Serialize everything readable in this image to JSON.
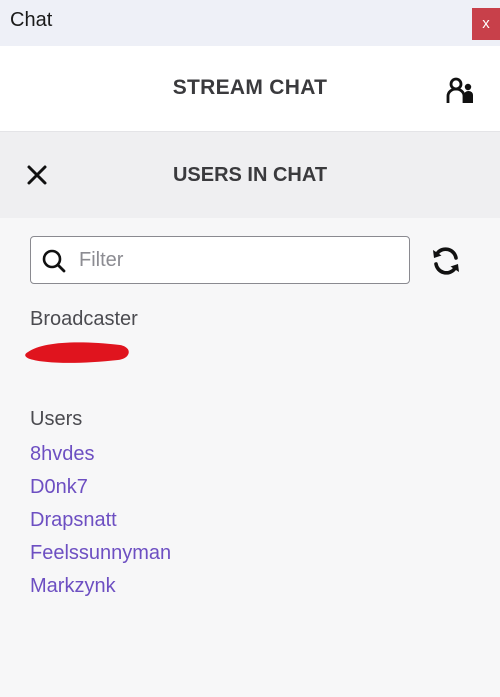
{
  "window": {
    "title": "Chat",
    "close_label": "x"
  },
  "header": {
    "title": "STREAM CHAT",
    "users_icon": "users-icon"
  },
  "panel": {
    "title": "USERS IN CHAT",
    "close_icon": "close-icon"
  },
  "filter": {
    "placeholder": "Filter",
    "value": ""
  },
  "refresh_icon": "refresh-icon",
  "broadcaster": {
    "label": "Broadcaster"
  },
  "users": {
    "label": "Users",
    "items": [
      "8hvdes",
      "D0nk7",
      "Drapsnatt",
      "Feelssunnyman",
      "Markzynk"
    ]
  },
  "colors": {
    "accent": "#6d4fc2",
    "close_button": "#c8404a",
    "redaction": "#e0141e"
  }
}
